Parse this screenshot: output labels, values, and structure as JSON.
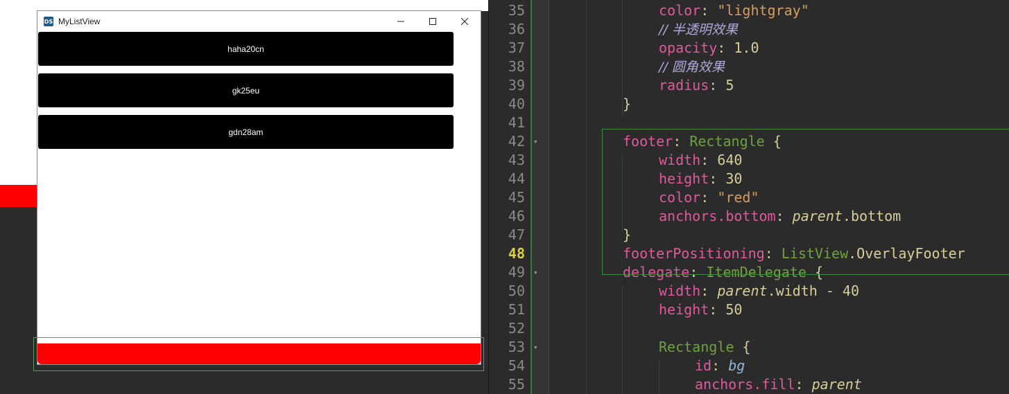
{
  "window": {
    "title": "MyListView",
    "icon_text": "DS",
    "items": [
      "haha20cn",
      "gk25eu",
      "gdn28am"
    ]
  },
  "editor": {
    "lines": [
      {
        "n": "35",
        "indent": 1,
        "tokens": [
          [
            "prop",
            "color"
          ],
          [
            "plain",
            ": "
          ],
          [
            "str",
            "\"lightgray\""
          ]
        ]
      },
      {
        "n": "36",
        "indent": 1,
        "tokens": [
          [
            "comment",
            "// 半透明效果"
          ]
        ]
      },
      {
        "n": "37",
        "indent": 1,
        "tokens": [
          [
            "prop",
            "opacity"
          ],
          [
            "plain",
            ": 1.0"
          ]
        ]
      },
      {
        "n": "38",
        "indent": 1,
        "tokens": [
          [
            "comment",
            "// 圆角效果"
          ]
        ]
      },
      {
        "n": "39",
        "indent": 1,
        "tokens": [
          [
            "prop",
            "radius"
          ],
          [
            "plain",
            ": 5"
          ]
        ]
      },
      {
        "n": "40",
        "indent": 0,
        "tokens": [
          [
            "plain",
            "}"
          ]
        ]
      },
      {
        "n": "41",
        "indent": 0,
        "tokens": []
      },
      {
        "n": "42",
        "indent": 0,
        "fold": true,
        "tokens": [
          [
            "prop",
            "footer"
          ],
          [
            "plain",
            ": "
          ],
          [
            "type",
            "Rectangle"
          ],
          [
            "plain",
            " {"
          ]
        ]
      },
      {
        "n": "43",
        "indent": 1,
        "tokens": [
          [
            "prop",
            "width"
          ],
          [
            "plain",
            ": 640"
          ]
        ]
      },
      {
        "n": "44",
        "indent": 1,
        "tokens": [
          [
            "prop",
            "height"
          ],
          [
            "plain",
            ": 30"
          ]
        ]
      },
      {
        "n": "45",
        "indent": 1,
        "tokens": [
          [
            "prop",
            "color"
          ],
          [
            "plain",
            ": "
          ],
          [
            "str",
            "\"red\""
          ]
        ]
      },
      {
        "n": "46",
        "indent": 1,
        "tokens": [
          [
            "prop",
            "anchors.bottom"
          ],
          [
            "plain",
            ": "
          ],
          [
            "it",
            "parent"
          ],
          [
            "plain",
            ".bottom"
          ]
        ]
      },
      {
        "n": "47",
        "indent": 0,
        "tokens": [
          [
            "plain",
            "}"
          ]
        ]
      },
      {
        "n": "48",
        "indent": 0,
        "current": true,
        "tokens": [
          [
            "prop",
            "footerPositioning"
          ],
          [
            "plain",
            ": "
          ],
          [
            "type",
            "ListView"
          ],
          [
            "plain",
            "."
          ],
          [
            "plain",
            "OverlayFooter"
          ]
        ]
      },
      {
        "n": "49",
        "indent": 0,
        "fold": true,
        "tokens": [
          [
            "prop",
            "delegate"
          ],
          [
            "plain",
            ": "
          ],
          [
            "type",
            "ItemDelegate"
          ],
          [
            "plain",
            " {"
          ]
        ]
      },
      {
        "n": "50",
        "indent": 1,
        "tokens": [
          [
            "prop",
            "width"
          ],
          [
            "plain",
            ": "
          ],
          [
            "it",
            "parent"
          ],
          [
            "plain",
            ".width - 40"
          ]
        ]
      },
      {
        "n": "51",
        "indent": 1,
        "tokens": [
          [
            "prop",
            "height"
          ],
          [
            "plain",
            ": 50"
          ]
        ]
      },
      {
        "n": "52",
        "indent": 0,
        "tokens": []
      },
      {
        "n": "53",
        "indent": 1,
        "fold": true,
        "tokens": [
          [
            "type",
            "Rectangle"
          ],
          [
            "plain",
            " {"
          ]
        ]
      },
      {
        "n": "54",
        "indent": 2,
        "tokens": [
          [
            "prop",
            "id"
          ],
          [
            "plain",
            ": "
          ],
          [
            "italic-prop",
            "bg"
          ]
        ]
      },
      {
        "n": "55",
        "indent": 2,
        "tokens": [
          [
            "prop",
            "anchors.fill"
          ],
          [
            "plain",
            ": "
          ],
          [
            "it",
            "parent"
          ]
        ]
      }
    ]
  },
  "colors": {
    "footer_red": "#ff0000",
    "item_black": "#000000",
    "highlight_green": "#3e8a46"
  }
}
